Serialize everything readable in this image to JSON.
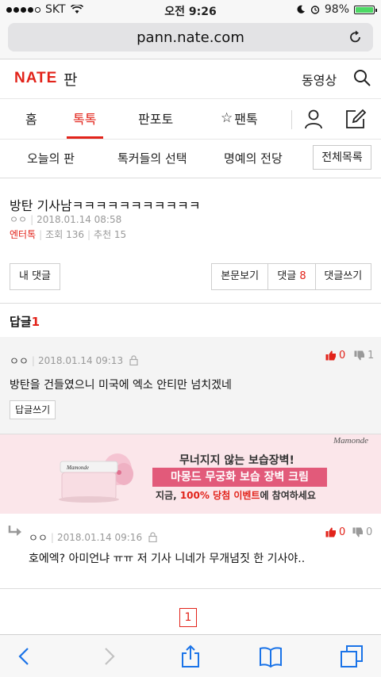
{
  "status": {
    "carrier": "SKT",
    "time": "오전 9:26",
    "battery": "98%",
    "battery_level": 0.98
  },
  "browser": {
    "url": "pann.nate.com"
  },
  "header": {
    "logo": "NATE",
    "logo_sub": "판",
    "video_link": "동영상"
  },
  "nav": {
    "items": [
      "홈",
      "톡톡",
      "판포토",
      "팬톡"
    ],
    "active": 1
  },
  "subnav": {
    "items": [
      "오늘의 판",
      "톡커들의 선택",
      "명예의 전당"
    ],
    "all_label": "전체목록"
  },
  "article": {
    "title": "방탄 기사남ㅋㅋㅋㅋㅋㅋㅋㅋㅋㅋㅋ",
    "author": "ㅇㅇ",
    "date": "2018.01.14 08:58",
    "category": "엔터톡",
    "views": "조회 136",
    "recommend": "추천 15"
  },
  "buttons": {
    "my_comments": "내 댓글",
    "view_body": "본문보기",
    "comments_label": "댓글",
    "comments_count": "8",
    "write_comment": "댓글쓰기"
  },
  "replies": {
    "label": "답글",
    "count": "1"
  },
  "comments": [
    {
      "author": "ㅇㅇ",
      "date": "2018.01.14 09:13",
      "text": "방탄을 건들였으니 미국에 엑소 안티만 넘치겠네",
      "reply_btn": "답글쓰기",
      "up": "0",
      "down": "1"
    },
    {
      "author": "ㅇㅇ",
      "date": "2018.01.14 09:16",
      "text": "호에엑? 아미언냐 ㅠㅠ 저 기사 니네가 무개념짓 한 기사야..",
      "up": "0",
      "down": "0"
    }
  ],
  "ad": {
    "brand": "Mamonde",
    "jar_brand": "Mamonde",
    "line1": "무너지지 않는 보습장벽!",
    "line2": "마몽드 무궁화 보습 장벽 크림",
    "line3_a": "지금, ",
    "line3_b": "100% 당첨 이벤트",
    "line3_c": "에 참여하세요"
  },
  "pagination": {
    "current": "1"
  },
  "colors": {
    "brand": "#e2231a",
    "ad_bg": "#fbe6ea"
  }
}
